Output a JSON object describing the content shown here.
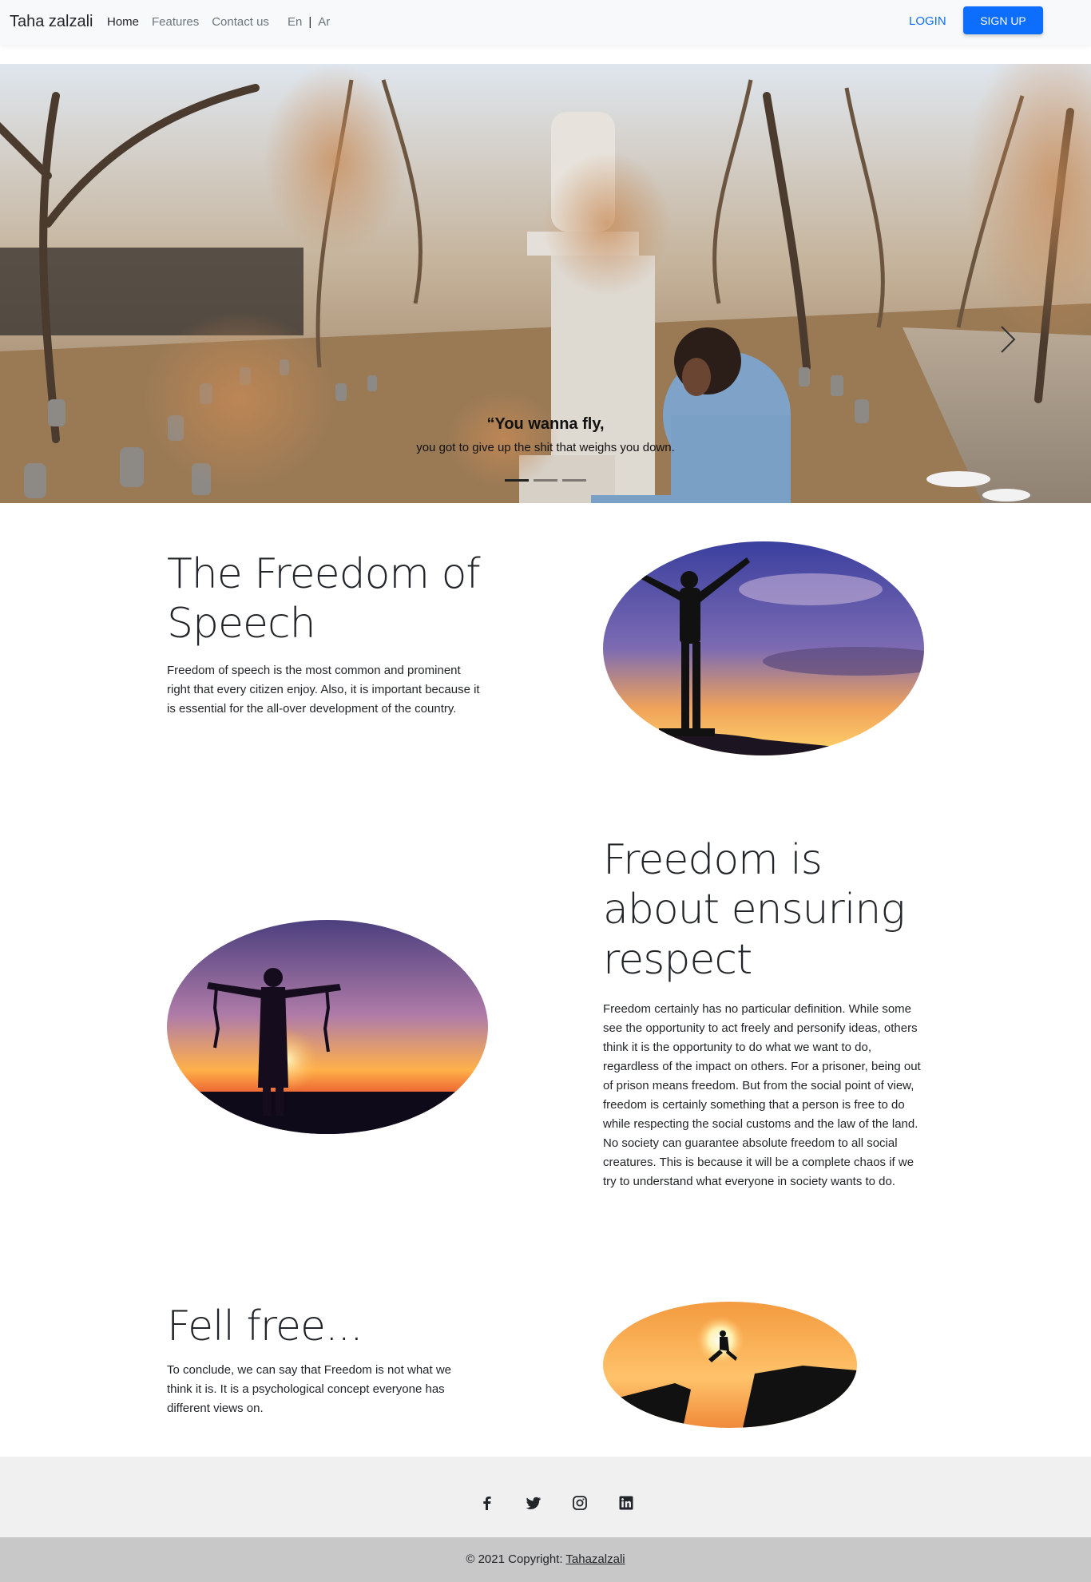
{
  "navbar": {
    "brand": "Taha zalzali",
    "links": [
      "Home",
      "Features",
      "Contact us"
    ],
    "lang_en": "En",
    "lang_sep": "|",
    "lang_ar": "Ar",
    "login": "LOGIN",
    "signup": "SIGN UP"
  },
  "hero": {
    "caption_title": "“You wanna fly,",
    "caption_text": "you got to give up the shit that weighs you down.",
    "slide_count": 3,
    "active_slide": 1
  },
  "sections": [
    {
      "title": "The Freedom of Speech",
      "text": "Freedom of speech is the most common and prominent right that every citizen enjoy. Also, it is important because it is essential for the all-over development of the country."
    },
    {
      "title": "Freedom is about ensuring respect",
      "text": "Freedom certainly has no particular definition. While some see the opportunity to act freely and personify ideas, others think it is the opportunity to do what we want to do, regardless of the impact on others. For a prisoner, being out of prison means freedom. But from the social point of view, freedom is certainly something that a person is free to do while respecting the social customs and the law of the land. No society can guarantee absolute freedom to all social creatures. This is because it will be a complete chaos if we try to understand what everyone in society wants to do."
    },
    {
      "title": "Fell free...",
      "text": "To conclude, we can say that Freedom is not what we think it is. It is a psychological concept everyone has different views on."
    }
  ],
  "footer": {
    "socials": [
      "facebook-icon",
      "twitter-icon",
      "instagram-icon",
      "linkedin-icon"
    ],
    "copyright_prefix": "© 2021 Copyright: ",
    "copyright_link": "Tahazalzali"
  },
  "colors": {
    "primary": "#0d6efd",
    "navbar_bg": "#f8f9fa",
    "footer_bg": "#f0f0f0",
    "copyright_bg": "#c8c8c8"
  }
}
